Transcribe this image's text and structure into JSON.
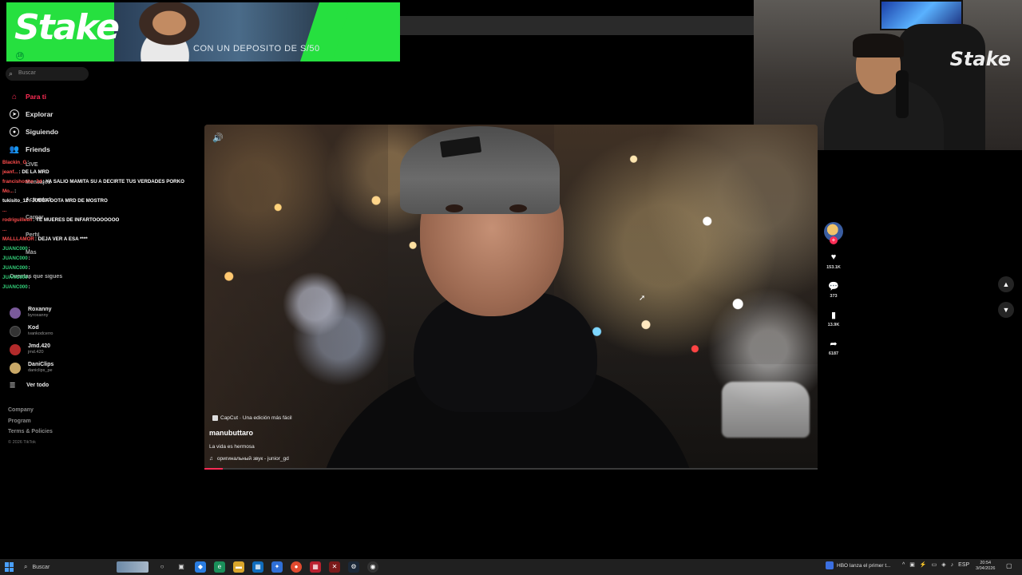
{
  "banner": {
    "logo": "Stake",
    "age": "18",
    "cta": "CON UN DEPOSITO DE S/50"
  },
  "webcam": {
    "watermark": "Stake"
  },
  "sidebar": {
    "search_placeholder": "Buscar",
    "nav": [
      {
        "label": "Para ti",
        "icon": "home-icon",
        "active": true
      },
      {
        "label": "Explorar",
        "icon": "compass-icon"
      },
      {
        "label": "Siguiendo",
        "icon": "following-icon"
      },
      {
        "label": "Friends",
        "icon": "friends-icon"
      }
    ],
    "hidden_nav": [
      "LIVE",
      "Mensajes",
      "Actividad",
      "Cargar",
      "Perfil",
      "Más",
      "Cuentas que sigues"
    ],
    "following": [
      {
        "name": "Roxanny",
        "handle": "byroxanny",
        "color": "#7a5a9a"
      },
      {
        "name": "Kod",
        "handle": "ivankodcerro",
        "color": "#333333"
      },
      {
        "name": "Jmd.420",
        "handle": "jmd.420",
        "color": "#b22a2a"
      },
      {
        "name": "DaniClips",
        "handle": "daniclips_pe",
        "color": "#c9a867"
      }
    ],
    "see_all": "Ver todo",
    "footer": [
      "Company",
      "Program",
      "Terms & Policies"
    ],
    "copyright": "© 2026 TikTok"
  },
  "chat": [
    {
      "user": "Blackin_G",
      "text": ":",
      "color": "#ff4d4d"
    },
    {
      "user": "jeanf...",
      "text": ": DE LA MRD",
      "color": "#ff4d4d"
    },
    {
      "user": "francishosho_3d",
      "text": ": YA SALIO MAMITA SU A DECIRTE TUS VERDADES PORKO",
      "color": "#ff4d4d"
    },
    {
      "user": "Mo...",
      "text": ":",
      "color": "#ff4d4d"
    },
    {
      "user": "tukisito_12",
      "text": ": JUEGA DOTA MRD DE MOSTRO",
      "color": "#ffffff"
    },
    {
      "user": "...",
      "text": "",
      "color": "#ff4d4d"
    },
    {
      "user": "rodriguilleen",
      "text": ": TE MUERES DE INFARTOOOOOOO",
      "color": "#ff4d4d"
    },
    {
      "user": "...",
      "text": "",
      "color": "#ff4d4d"
    },
    {
      "user": "MALLLAMOR",
      "text": ": DEJA VER A ESA ****",
      "color": "#ff4d4d"
    },
    {
      "user": "JUANC000",
      "text": ":",
      "color": "#33d17a"
    },
    {
      "user": "JUANC000",
      "text": ":",
      "color": "#33d17a"
    },
    {
      "user": "JUANC000",
      "text": ":",
      "color": "#33d17a"
    },
    {
      "user": "JUANC000",
      "text": ":",
      "color": "#33d17a"
    },
    {
      "user": "JUANC000",
      "text": ":",
      "color": "#33d17a"
    }
  ],
  "video": {
    "capcut_label": "CapCut · Una edición más fácil",
    "author": "manubuttaro",
    "description": "La vida es hermosa",
    "sound": "оригинальный звук - junior_gd",
    "progress": 0.03
  },
  "actions": {
    "likes": "153.1K",
    "comments": "373",
    "saves": "13.9K",
    "shares": "6187"
  },
  "taskbar": {
    "search": "Buscar",
    "news": "HBO lanza el primer t...",
    "lang": "ESP",
    "time": "20:54",
    "date": "3/04/2026"
  }
}
